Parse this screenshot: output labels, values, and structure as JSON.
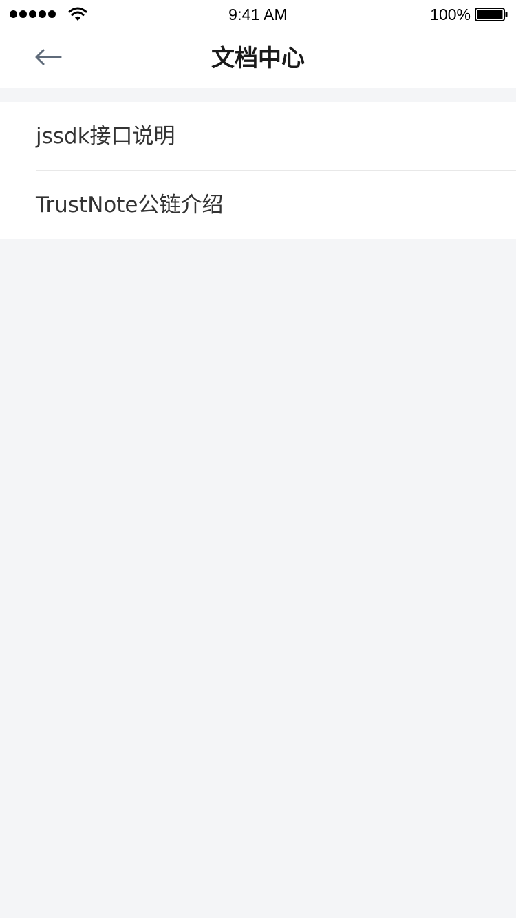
{
  "status_bar": {
    "time": "9:41 AM",
    "battery": "100%",
    "icons": [
      "signal-icon",
      "wifi-icon",
      "battery-icon"
    ]
  },
  "nav": {
    "back_icon": "back-arrow-icon",
    "title": "文档中心"
  },
  "list": {
    "items": [
      {
        "label": "jssdk接口说明"
      },
      {
        "label": "TrustNote公链介绍"
      }
    ]
  },
  "colors": {
    "background": "#f4f5f7",
    "surface": "#ffffff",
    "title_text": "#1a1a1a",
    "item_text": "#333333",
    "divider": "#e8e8e8",
    "back_arrow": "#5f6b7a"
  }
}
